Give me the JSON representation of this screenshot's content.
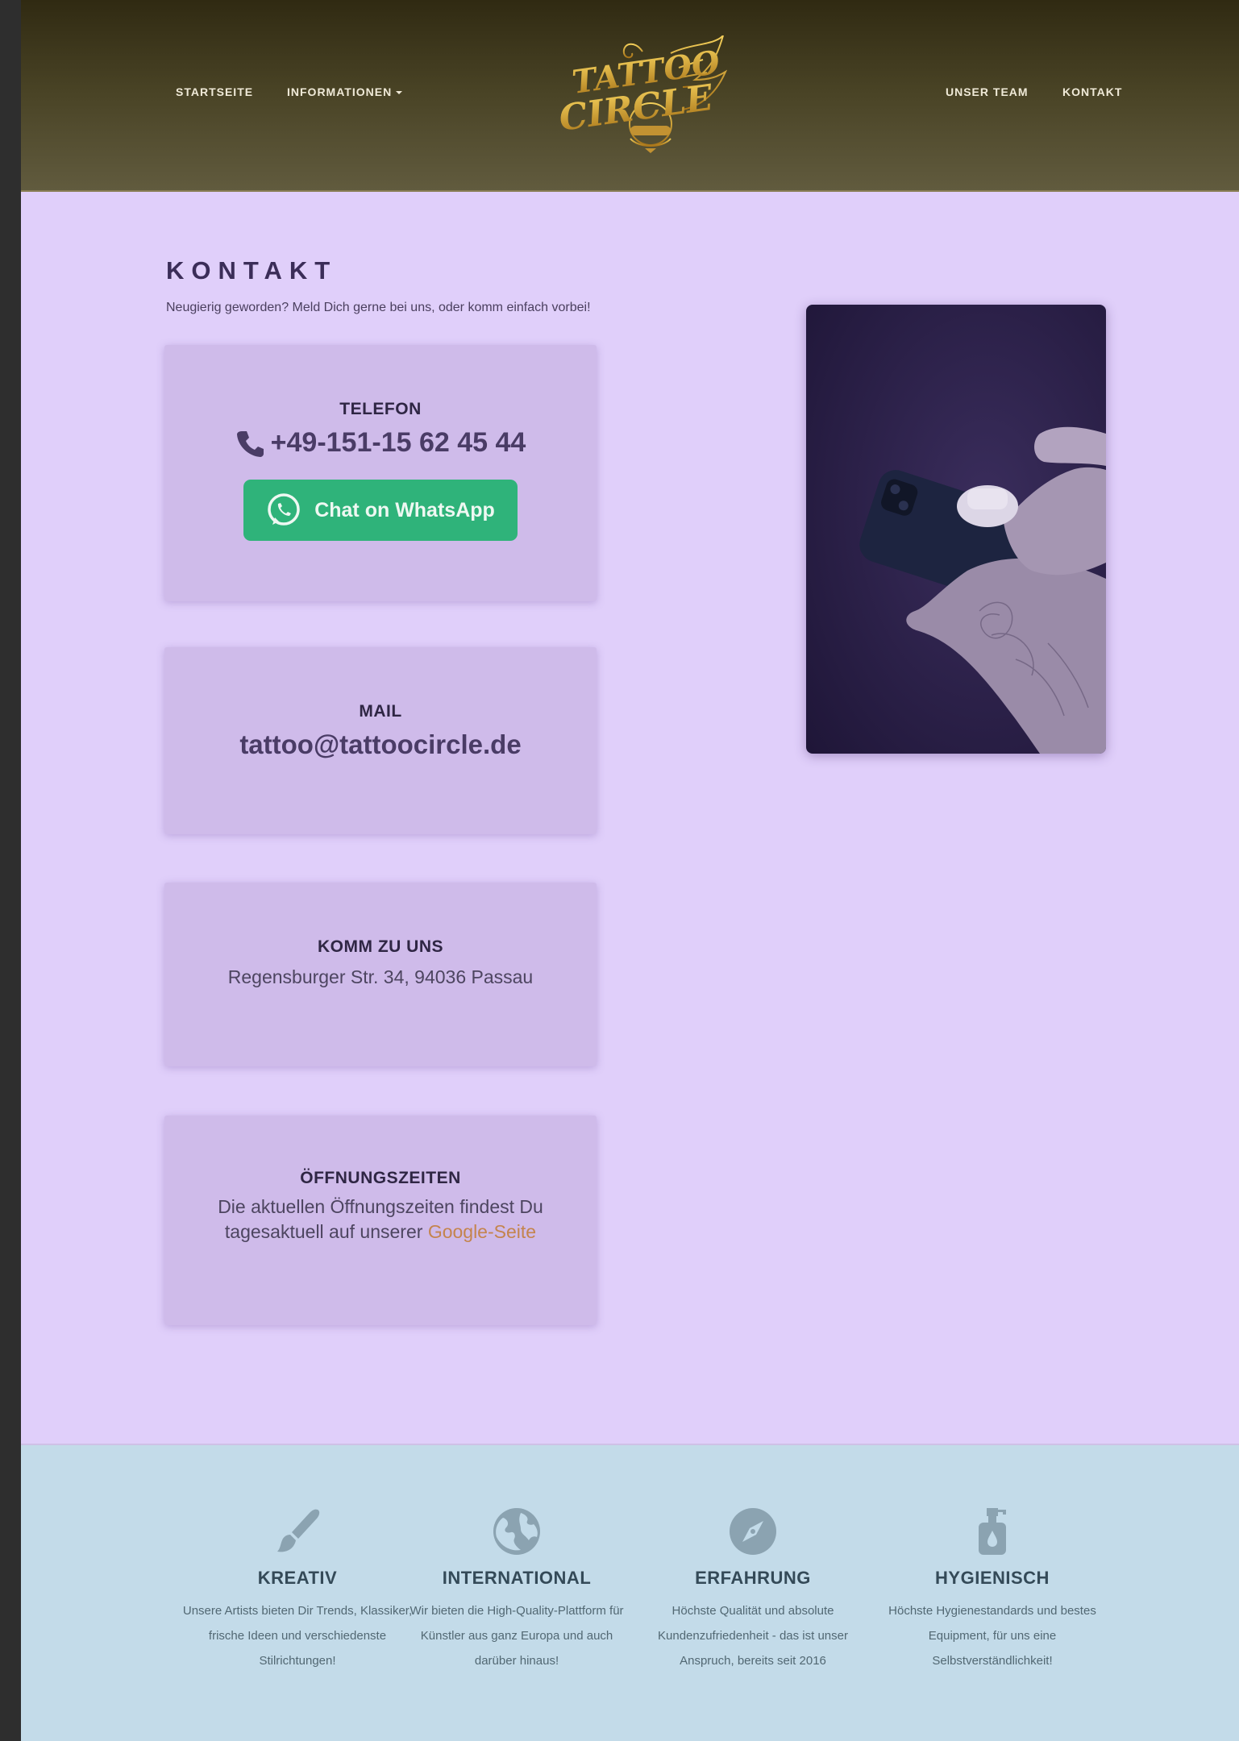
{
  "header": {
    "nav_left": [
      "STARTSEITE",
      "INFORMATIONEN"
    ],
    "nav_right": [
      "UNSER TEAM",
      "KONTAKT"
    ],
    "logo_text": "TATTOO CIRCLE"
  },
  "contact": {
    "heading": "KONTAKT",
    "intro": "Neugierig geworden? Meld Dich gerne bei uns, oder komm einfach vorbei!",
    "phone": {
      "title": "TELEFON",
      "number": "+49-151-15 62 45 44",
      "whatsapp_label": "Chat on WhatsApp"
    },
    "mail": {
      "title": "MAIL",
      "address": "tattoo@tattoocircle.de"
    },
    "address": {
      "title": "KOMM ZU UNS",
      "text": "Regensburger Str. 34, 94036 Passau"
    },
    "hours": {
      "title": "ÖFFNUNGSZEITEN",
      "text": "Die aktuellen Öffnungszeiten findest Du tagesaktuell auf unserer",
      "link": "Google-Seite"
    }
  },
  "features": [
    {
      "icon": "paintbrush-icon",
      "title": "KREATIV",
      "text": "Unsere Artists bieten Dir Trends, Klassiker, frische Ideen und verschiedenste Stilrichtungen!"
    },
    {
      "icon": "globe-icon",
      "title": "INTERNATIONAL",
      "text": "Wir bieten die High-Quality-Plattform für Künstler aus ganz Europa und auch darüber hinaus!"
    },
    {
      "icon": "compass-icon",
      "title": "ERFAHRUNG",
      "text": "Höchste Qualität und absolute Kundenzufriedenheit - das ist unser Anspruch, bereits seit 2016"
    },
    {
      "icon": "soap-dispenser-icon",
      "title": "HYGIENISCH",
      "text": "Höchste Hygienestandards und bestes Equipment, für uns eine Selbstverständlichkeit!"
    }
  ],
  "colors": {
    "page_bg": "#e0cffa",
    "card_bg": "#cfbbea",
    "whatsapp": "#2fb37a",
    "link": "#c4844d",
    "features_bg": "#c3dbe9"
  }
}
